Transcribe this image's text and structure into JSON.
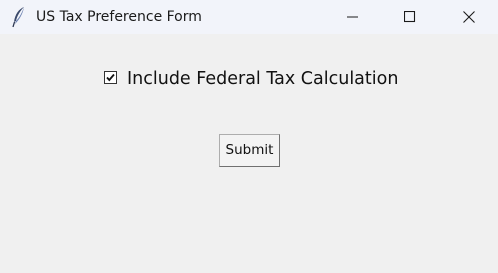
{
  "window": {
    "title": "US Tax Preference Form",
    "icons": {
      "app": "feather-icon",
      "minimize": "minimize-icon",
      "maximize": "maximize-icon",
      "close": "close-icon"
    }
  },
  "form": {
    "federal_tax_checkbox": {
      "label": "Include Federal Tax Calculation",
      "checked": true
    },
    "submit_label": "Submit"
  }
}
